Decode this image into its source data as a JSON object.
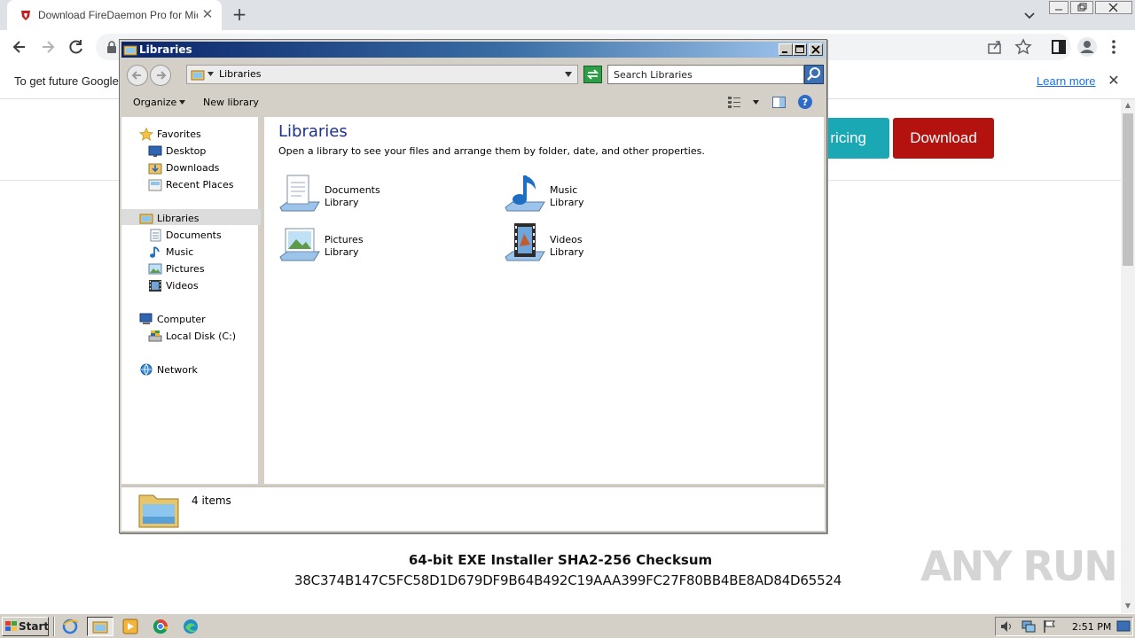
{
  "browser": {
    "tab_title": "Download FireDaemon Pro for Micro",
    "tab_close": "✕",
    "new_tab": "+",
    "infobar_text": "To get future Google",
    "infobar_learn_more": "Learn more",
    "infobar_close": "✕"
  },
  "site": {
    "pricing_label": "ricing",
    "download_label": "Download",
    "checksum_title": "64-bit EXE Installer SHA2-256 Checksum",
    "checksum_value": "38C374B147C5FC58D1D679DF9B64B492C19AAA399FC27F80BB4BE8AD84D65524",
    "watermark": "ANY RUN"
  },
  "explorer": {
    "title": "Libraries",
    "address": "Libraries",
    "search_placeholder": "Search Libraries",
    "commands": {
      "organize": "Organize",
      "new_library": "New library"
    },
    "nav": {
      "favorites": "Favorites",
      "desktop": "Desktop",
      "downloads": "Downloads",
      "recent_places": "Recent Places",
      "libraries": "Libraries",
      "documents": "Documents",
      "music": "Music",
      "pictures": "Pictures",
      "videos": "Videos",
      "computer": "Computer",
      "local_disk": "Local Disk (C:)",
      "network": "Network"
    },
    "content_title": "Libraries",
    "content_desc": "Open a library to see your files and arrange them by folder, date, and other properties.",
    "libraries": [
      {
        "name": "Documents",
        "type": "Library"
      },
      {
        "name": "Music",
        "type": "Library"
      },
      {
        "name": "Pictures",
        "type": "Library"
      },
      {
        "name": "Videos",
        "type": "Library"
      }
    ],
    "status": "4 items"
  },
  "taskbar": {
    "start": "Start",
    "clock": "2:51 PM"
  },
  "colors": {
    "download_red": "#b3120f",
    "pricing_teal": "#1aa8b5",
    "title_blue": "#0a246a"
  }
}
